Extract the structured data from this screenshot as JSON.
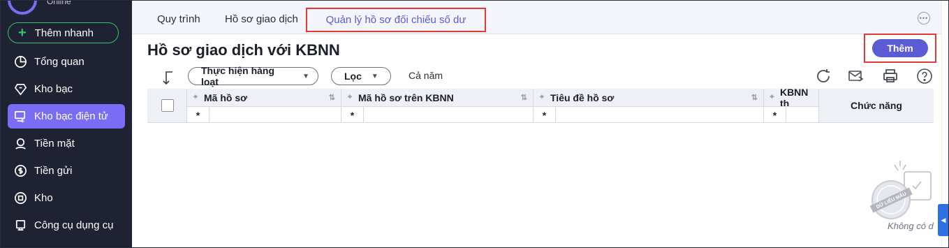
{
  "brand": {
    "subtitle": "Online"
  },
  "sidebar": {
    "quick_add": "Thêm nhanh",
    "items": [
      {
        "label": "Tổng quan",
        "icon": "pie-chart-icon"
      },
      {
        "label": "Kho bạc",
        "icon": "treasury-icon"
      },
      {
        "label": "Kho bạc điện tử",
        "icon": "e-treasury-icon",
        "active": true
      },
      {
        "label": "Tiền mặt",
        "icon": "cash-icon"
      },
      {
        "label": "Tiền gửi",
        "icon": "deposit-icon"
      },
      {
        "label": "Kho",
        "icon": "warehouse-icon"
      },
      {
        "label": "Công cụ dụng cụ",
        "icon": "tools-icon"
      }
    ]
  },
  "tabs": [
    {
      "label": "Quy trình"
    },
    {
      "label": "Hồ sơ giao dịch"
    },
    {
      "label": "Quản lý hồ sơ đối chiếu số dư",
      "active": true
    }
  ],
  "header": {
    "title": "Hồ sơ giao dịch với KBNN",
    "add_label": "Thêm"
  },
  "toolbar": {
    "bulk_label": "Thực hiện hàng loạt",
    "filter_label": "Lọc",
    "period": "Cả năm"
  },
  "grid": {
    "columns": [
      {
        "label": "Mã hồ sơ"
      },
      {
        "label": "Mã hồ sơ trên KBNN"
      },
      {
        "label": "Tiêu đề hồ sơ"
      },
      {
        "label": "KBNN th"
      }
    ],
    "filter_symbol": "*",
    "func_label": "Chức năng"
  },
  "empty": {
    "stamp_text": "DỮ LIỆU MẪU",
    "message": "Không có d"
  },
  "colors": {
    "accent": "#5b5bd6",
    "sidebar_bg": "#1f2232",
    "highlight": "#e53935",
    "quick_add": "#35c46a"
  }
}
